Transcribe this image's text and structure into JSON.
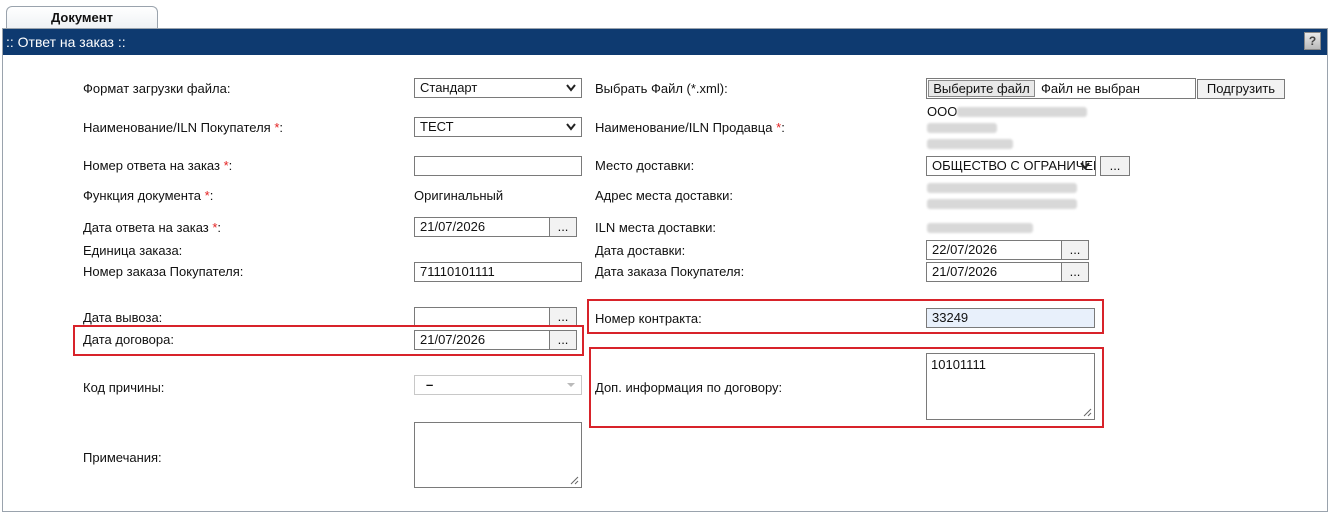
{
  "tab": {
    "label": "Документ"
  },
  "titlebar": {
    "title": ":: Ответ на заказ ::",
    "help_label": "?"
  },
  "left": {
    "format_label": "Формат загрузки файла:",
    "format_value": "Стандарт",
    "buyer_label": "Наименование/ILN Покупателя",
    "buyer_value": "ТЕСТ",
    "reply_number_label": "Номер ответа на заказ",
    "reply_number_value": "",
    "doc_function_label": "Функция документа",
    "doc_function_value": "Оригинальный",
    "reply_date_label": "Дата ответа на заказ",
    "reply_date_value": "21/07/2026",
    "order_unit_label": "Единица заказа:",
    "buyer_order_number_label": "Номер заказа Покупателя:",
    "buyer_order_number_value": "71110101111",
    "pickup_date_label": "Дата вывоза:",
    "pickup_date_value": "",
    "contract_date_label": "Дата договора:",
    "contract_date_value": "21/07/2026",
    "reason_code_label": "Код причины:",
    "reason_code_value": "–",
    "notes_label": "Примечания:",
    "notes_value": ""
  },
  "right": {
    "file_label": "Выбрать Файл (*.xml):",
    "choose_file_button": "Выберите файл",
    "file_status": "Файл не выбран",
    "upload_button": "Подгрузить",
    "seller_label": "Наименование/ILN Продавца",
    "seller_value_prefix": "ООО",
    "delivery_place_label": "Место доставки:",
    "delivery_place_value": "ОБЩЕСТВО С ОГРАНИЧЕН",
    "delivery_address_label": "Адрес места доставки:",
    "delivery_iln_label": "ILN места доставки:",
    "delivery_date_label": "Дата доставки:",
    "delivery_date_value": "22/07/2026",
    "buyer_order_date_label": "Дата заказа Покупателя:",
    "buyer_order_date_value": "21/07/2026",
    "contract_number_label": "Номер контракта:",
    "contract_number_value": "33249",
    "contract_info_label": "Доп. информация по договору:",
    "contract_info_value": "10101111"
  },
  "common": {
    "required_mark": "*",
    "colon": ":",
    "picker_label": "..."
  },
  "colors": {
    "header_bg": "#0e3a70",
    "required": "#e32121",
    "highlight": "#d8232a"
  }
}
